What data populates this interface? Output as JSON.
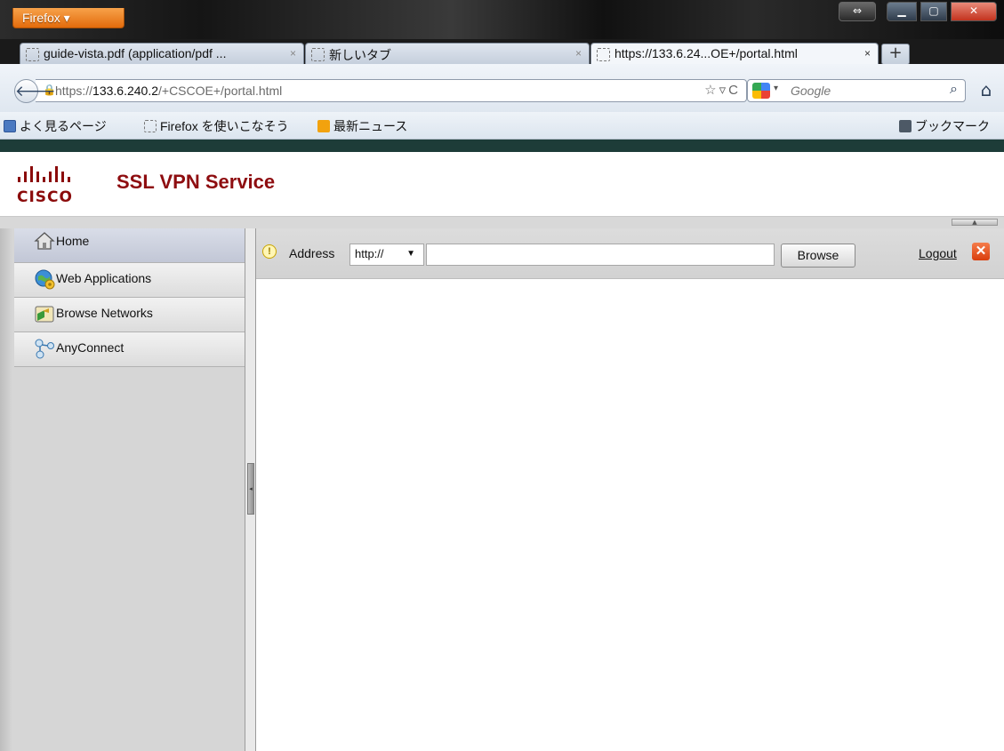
{
  "browser": {
    "menu_button": "Firefox ▾",
    "tabs": [
      {
        "label": "guide-vista.pdf (application/pdf ..."
      },
      {
        "label": "新しいタブ"
      },
      {
        "label": "https://133.6.24...OE+/portal.html"
      }
    ],
    "new_tab": "+",
    "url": {
      "scheme": "https://",
      "host": "133.6.240.2",
      "path": "/+CSCOE+/portal.html"
    },
    "search_placeholder": "Google",
    "bookmarks": [
      "よく見るページ",
      "Firefox を使いこなそう",
      "最新ニュース"
    ],
    "bookmarks_menu": "ブックマーク"
  },
  "portal": {
    "logo_word": "CISCO",
    "title": "SSL VPN Service",
    "nav": [
      {
        "label": "Home",
        "icon": "home-icon"
      },
      {
        "label": "Web Applications",
        "icon": "web-apps-icon"
      },
      {
        "label": "Browse Networks",
        "icon": "browse-networks-icon"
      },
      {
        "label": "AnyConnect",
        "icon": "anyconnect-icon"
      }
    ],
    "toolbar": {
      "address_label": "Address",
      "protocol": "http://",
      "address_value": "",
      "browse": "Browse",
      "logout": "Logout"
    }
  },
  "colors": {
    "brand_red": "#8e0d10",
    "firefox_orange": "#e36b0c",
    "sidebar_gray": "#d6d6d6"
  }
}
